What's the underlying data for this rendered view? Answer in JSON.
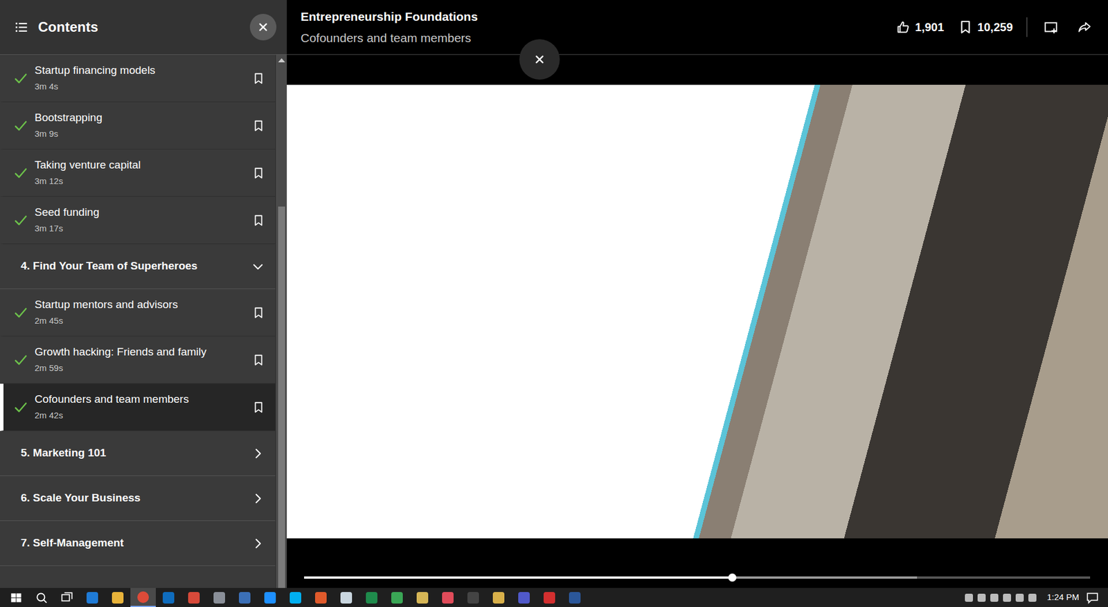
{
  "sidebar": {
    "title": "Contents",
    "rows": [
      {
        "kind": "lesson",
        "title": "Startup financing models",
        "duration": "3m 4s",
        "completed": true,
        "selected": false
      },
      {
        "kind": "lesson",
        "title": "Bootstrapping",
        "duration": "3m 9s",
        "completed": true,
        "selected": false
      },
      {
        "kind": "lesson",
        "title": "Taking venture capital",
        "duration": "3m 12s",
        "completed": true,
        "selected": false
      },
      {
        "kind": "lesson",
        "title": "Seed funding",
        "duration": "3m 17s",
        "completed": true,
        "selected": false
      },
      {
        "kind": "section",
        "title": "4. Find Your Team of Superheroes",
        "expanded": true
      },
      {
        "kind": "lesson",
        "title": "Startup mentors and advisors",
        "duration": "2m 45s",
        "completed": true,
        "selected": false
      },
      {
        "kind": "lesson",
        "title": "Growth hacking: Friends and family",
        "duration": "2m 59s",
        "completed": true,
        "selected": false
      },
      {
        "kind": "lesson",
        "title": "Cofounders and team members",
        "duration": "2m 42s",
        "completed": true,
        "selected": true
      },
      {
        "kind": "section",
        "title": "5. Marketing 101",
        "expanded": false
      },
      {
        "kind": "section",
        "title": "6. Scale Your Business",
        "expanded": false
      },
      {
        "kind": "section",
        "title": "7. Self-Management",
        "expanded": false
      }
    ],
    "scrollbar": {
      "offset": 0.27,
      "level": 0.73
    }
  },
  "header": {
    "course": "Entrepreneurship Foundations",
    "lesson": "Cofounders and team members",
    "likes": "1,901",
    "saves": "10,259"
  },
  "player": {
    "progress": {
      "level": 0.545,
      "buffered": 0.78
    }
  },
  "taskbar": {
    "clock": "1:24 PM"
  }
}
